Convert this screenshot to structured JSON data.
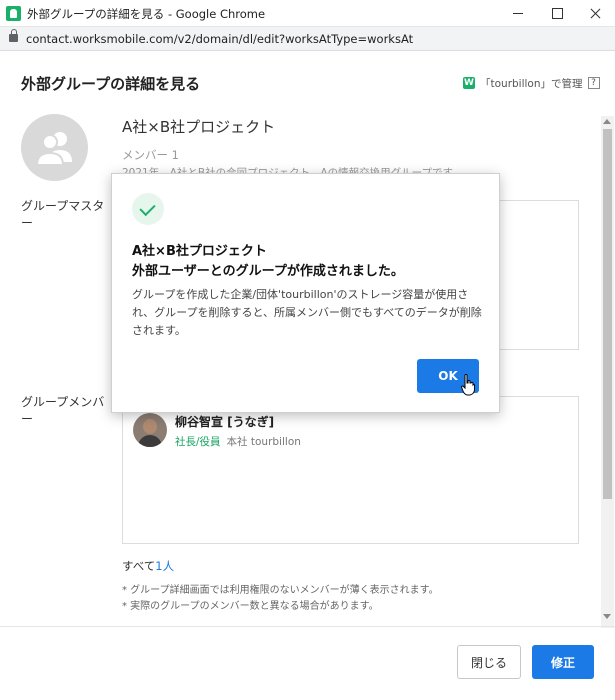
{
  "window": {
    "title": "外部グループの詳細を見る - Google Chrome",
    "url": "contact.worksmobile.com/v2/domain/dl/edit?worksAtType=worksAt"
  },
  "page": {
    "title": "外部グループの詳細を見る",
    "manage_icon_letter": "W",
    "manage_label": "「tourbillon」で管理",
    "help_label": "?"
  },
  "group": {
    "name": "A社×B社プロジェクト",
    "member_count": "メンバー 1",
    "description": "2021年、A社とB社の合同プロジェクト、Aの情報交換用グループです"
  },
  "labels": {
    "master": "グループマスター",
    "members": "グループメンバー"
  },
  "member": {
    "name": "柳谷智宣 [うなぎ]",
    "role": "社長/役員",
    "org": "本社 tourbillon"
  },
  "total": {
    "prefix": "すべて",
    "count": "1人"
  },
  "notes": [
    "* グループ詳細画面では利用権限のないメンバーが薄く表示されます。",
    "* 実際のグループのメンバー数と異なる場合があります。"
  ],
  "buttons": {
    "close": "閉じる",
    "edit": "修正"
  },
  "dialog": {
    "title_line1": "A社×B社プロジェクト",
    "title_line2": "外部ユーザーとのグループが作成されました。",
    "body": "グループを作成した企業/団体'tourbillon'のストレージ容量が使用され、グループを削除すると、所属メンバー側でもすべてのデータが削除されます。",
    "ok": "OK"
  },
  "colors": {
    "accent": "#1b7ae6",
    "brand_green": "#19b06a",
    "role_green": "#19a463"
  }
}
